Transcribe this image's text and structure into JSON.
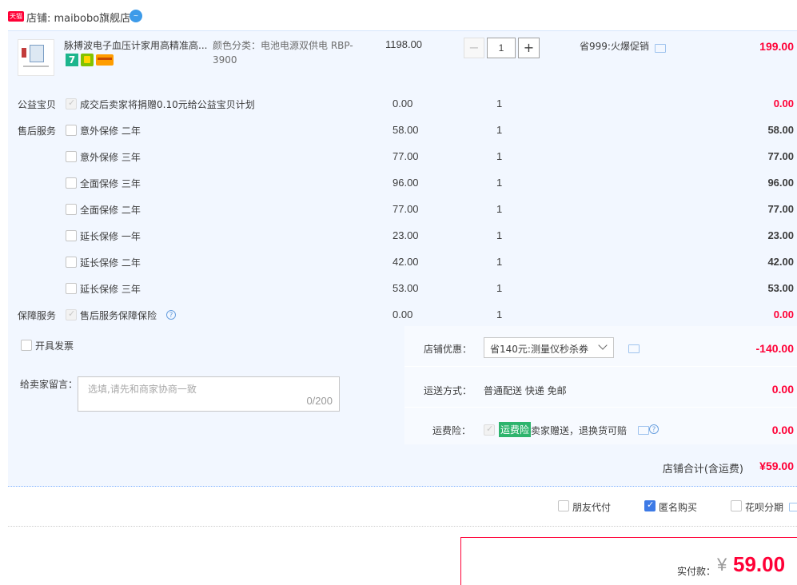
{
  "shop": {
    "badge": "天猫",
    "label": "店铺: maibobo旗舰店"
  },
  "product": {
    "title": "脉搏波电子血压计家用高精准高...",
    "spec_line1": "颜色分类：电池电源双供电 RBP-",
    "spec_line2": "3900",
    "price": "1198.00",
    "qty": "1",
    "promo": "省999:火爆促销",
    "total": "199.00",
    "badge7": "7"
  },
  "addon_rows": [
    {
      "group": "公益宝贝",
      "label": "成交后卖家将捐赠0.10元给公益宝贝计划",
      "price": "0.00",
      "qty": "1",
      "total": "0.00",
      "checkbox": "disabled",
      "red": true
    },
    {
      "group": "售后服务",
      "label": "意外保修 二年",
      "price": "58.00",
      "qty": "1",
      "total": "58.00",
      "checkbox": "empty",
      "red": false
    },
    {
      "group": "",
      "label": "意外保修 三年",
      "price": "77.00",
      "qty": "1",
      "total": "77.00",
      "checkbox": "empty",
      "red": false
    },
    {
      "group": "",
      "label": "全面保修 三年",
      "price": "96.00",
      "qty": "1",
      "total": "96.00",
      "checkbox": "empty",
      "red": false
    },
    {
      "group": "",
      "label": "全面保修 二年",
      "price": "77.00",
      "qty": "1",
      "total": "77.00",
      "checkbox": "empty",
      "red": false
    },
    {
      "group": "",
      "label": "延长保修 一年",
      "price": "23.00",
      "qty": "1",
      "total": "23.00",
      "checkbox": "empty",
      "red": false
    },
    {
      "group": "",
      "label": "延长保修 二年",
      "price": "42.00",
      "qty": "1",
      "total": "42.00",
      "checkbox": "empty",
      "red": false
    },
    {
      "group": "",
      "label": "延长保修 三年",
      "price": "53.00",
      "qty": "1",
      "total": "53.00",
      "checkbox": "empty",
      "red": false
    },
    {
      "group": "保障服务",
      "label": "售后服务保障保险",
      "price": "0.00",
      "qty": "1",
      "total": "0.00",
      "checkbox": "disabled",
      "red": true
    }
  ],
  "invoice": {
    "label": "开具发票"
  },
  "message": {
    "label": "给卖家留言：",
    "placeholder": "选填,请先和商家协商一致",
    "counter": "0/200"
  },
  "shop_discount": {
    "label": "店铺优惠：",
    "selected": "省140元:测量仪秒杀券",
    "amount": "-140.00"
  },
  "shipping": {
    "label": "运送方式：",
    "value": "普通配送 快递 免邮",
    "amount": "0.00"
  },
  "freight_insurance": {
    "label": "运费险：",
    "tag": "运费险",
    "desc": "卖家赠送，退换货可赔",
    "amount": "0.00"
  },
  "shop_total": {
    "label": "店铺合计(含运费)",
    "amount": "¥59.00"
  },
  "options": {
    "friend_pay": "朋友代付",
    "anonymous": "匿名购买",
    "huabei": "花呗分期"
  },
  "payment": {
    "label": "实付款：",
    "currency": "¥",
    "amount": "59.00"
  },
  "colors": {
    "accent_red": "#ff0036",
    "panel_bg": "#f2f7ff",
    "border_blue": "#b2d1ff"
  }
}
